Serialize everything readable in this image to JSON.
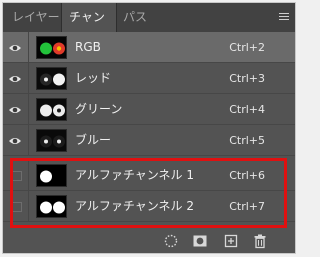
{
  "tabs": [
    {
      "label": "レイヤー",
      "active": false
    },
    {
      "label": "チャンネル",
      "active": true
    },
    {
      "label": "パス",
      "active": false
    }
  ],
  "channels": [
    {
      "name": "RGB",
      "shortcut": "Ctrl+2",
      "visible": true,
      "kind": "composite"
    },
    {
      "name": "レッド",
      "shortcut": "Ctrl+3",
      "visible": true,
      "kind": "red"
    },
    {
      "name": "グリーン",
      "shortcut": "Ctrl+4",
      "visible": true,
      "kind": "green"
    },
    {
      "name": "ブルー",
      "shortcut": "Ctrl+5",
      "visible": true,
      "kind": "blue"
    },
    {
      "name": "アルファチャンネル 1",
      "shortcut": "Ctrl+6",
      "visible": false,
      "kind": "alpha1"
    },
    {
      "name": "アルファチャンネル 2",
      "shortcut": "Ctrl+7",
      "visible": false,
      "kind": "alpha2"
    }
  ],
  "icons": {
    "panel_menu": "hamburger-icon",
    "eye": "eye-icon",
    "load_selection": "dotted-circle-icon",
    "save_selection": "mask-icon",
    "new_channel": "plus-square-icon",
    "delete": "trash-icon"
  },
  "colors": {
    "panel_bg": "#535353",
    "tab_bar_bg": "#424242",
    "row_highlight_bg": "#6a6a6a",
    "annotation_red": "#e01010"
  }
}
